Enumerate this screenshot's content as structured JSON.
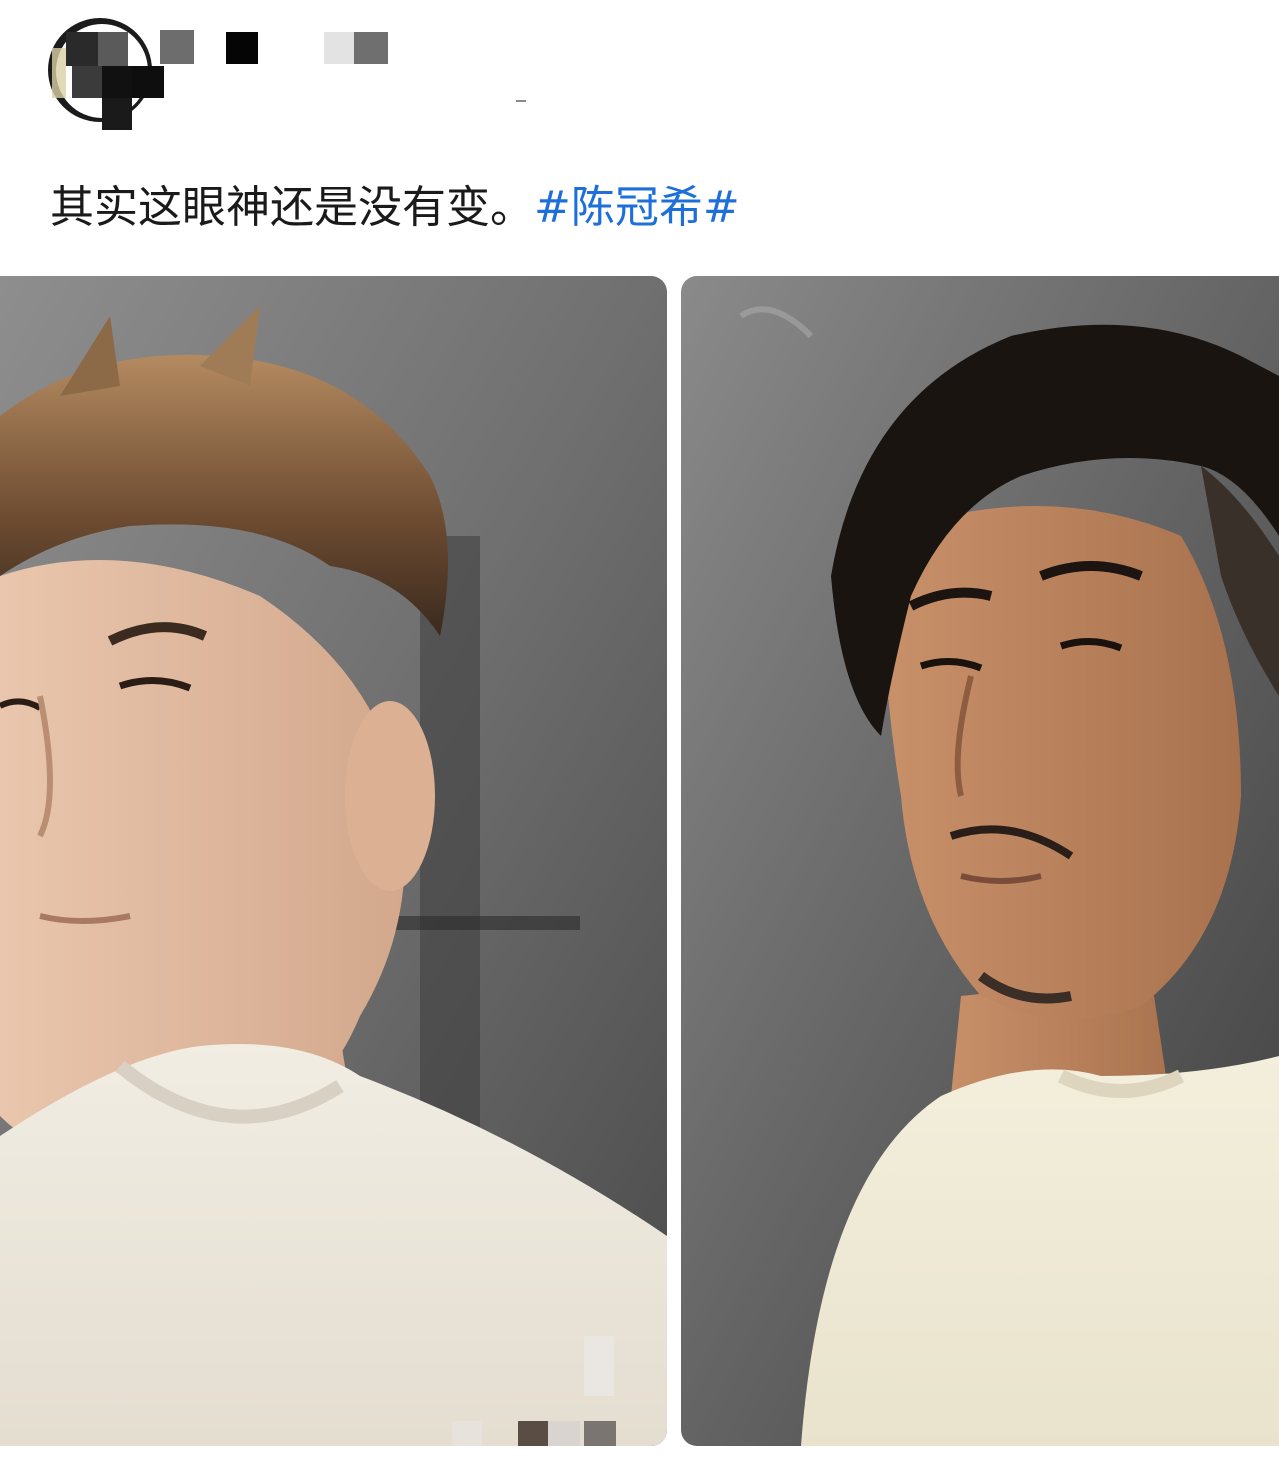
{
  "post": {
    "text": "其实这眼神还是没有变。",
    "hashtag": "#陈冠希#"
  },
  "colors": {
    "hashtag": "#1e6fd9",
    "text": "#1a1a1a",
    "background": "#ffffff"
  },
  "images": [
    {
      "alt_name": "photo-left"
    },
    {
      "alt_name": "photo-right"
    }
  ]
}
